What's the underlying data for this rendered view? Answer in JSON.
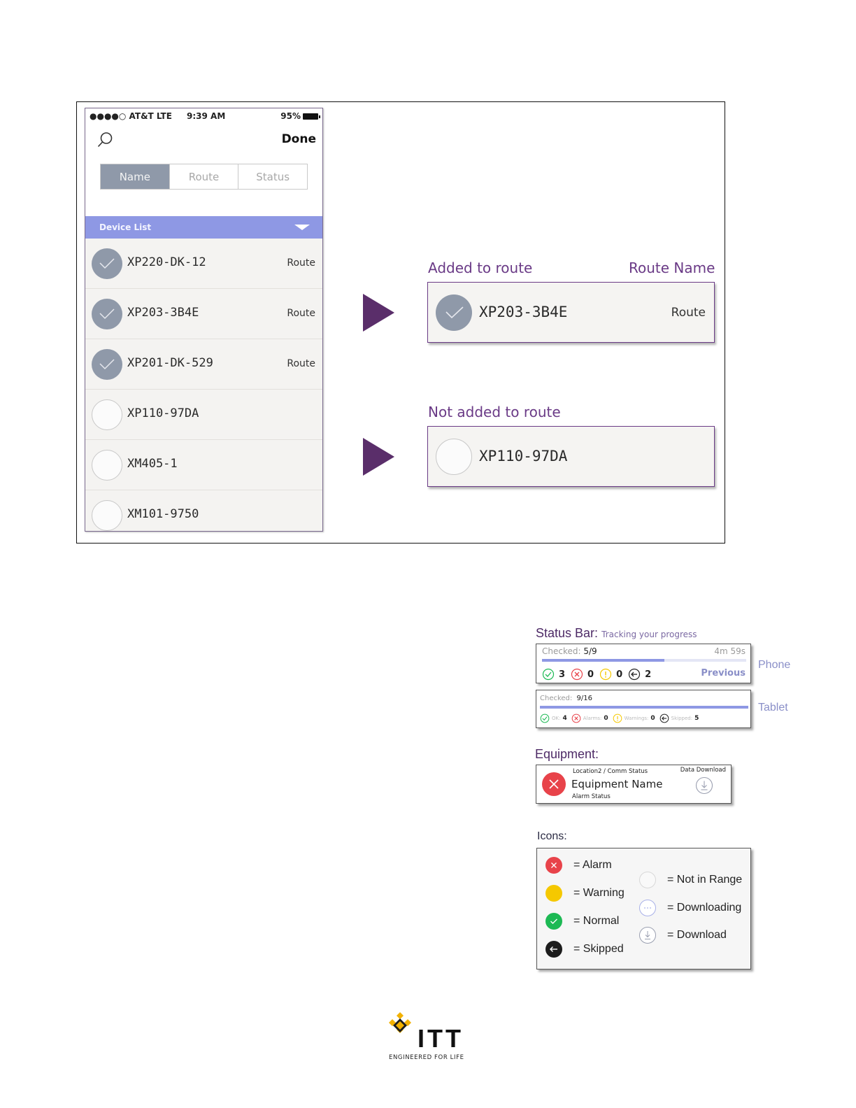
{
  "phone": {
    "carrier": "●●●●○ AT&T  LTE",
    "time": "9:39 AM",
    "battery": "95%",
    "done_label": "Done",
    "tabs": [
      {
        "label": "Name",
        "active": true
      },
      {
        "label": "Route",
        "active": false
      },
      {
        "label": "Status",
        "active": false
      }
    ],
    "device_list_label": "Device List",
    "devices": [
      {
        "name": "XP220-DK-12",
        "route": "Route",
        "checked": true
      },
      {
        "name": "XP203-3B4E",
        "route": "Route",
        "checked": true
      },
      {
        "name": "XP201-DK-529",
        "route": "Route",
        "checked": true
      },
      {
        "name": "XP110-97DA",
        "route": "",
        "checked": false
      },
      {
        "name": "XM405-1",
        "route": "",
        "checked": false
      },
      {
        "name": "XM101-9750",
        "route": "",
        "checked": false
      }
    ]
  },
  "callouts": {
    "added_label": "Added to route",
    "route_name_label": "Route Name",
    "added_card": {
      "name": "XP203-3B4E",
      "route": "Route"
    },
    "not_added_label": "Not added to route",
    "not_added_card": {
      "name": "XP110-97DA"
    }
  },
  "status_bar": {
    "title": "Status Bar:",
    "subtitle": "Tracking  your progress",
    "phone": {
      "checked_label": "Checked:",
      "checked_value": "5/9",
      "timer": "4m 59s",
      "progress": 0.6,
      "counts": {
        "normal": "3",
        "alarm": "0",
        "warning": "0",
        "skipped": "2"
      },
      "previous_label": "Previous",
      "side_label": "Phone"
    },
    "tablet": {
      "checked_label": "Checked:",
      "checked_value": "9/16",
      "progress": 1.0,
      "ok_label": "OK:",
      "ok_value": "4",
      "alarms_label": "Alarms:",
      "alarms_value": "0",
      "warnings_label": "Warnings:",
      "warnings_value": "0",
      "skipped_label": "Skipped:",
      "skipped_value": "5",
      "side_label": "Tablet"
    }
  },
  "equipment": {
    "title": "Equipment:",
    "location": "Location2 / Comm Status",
    "data_download": "Data Download",
    "name": "Equipment Name",
    "alarm_status": "Alarm Status"
  },
  "icons_legend": {
    "title": "Icons:",
    "left": [
      {
        "icon": "alarm-icon",
        "label": "= Alarm",
        "color": "#e8434a"
      },
      {
        "icon": "warning-icon",
        "label": "= Warning",
        "color": "#f5c800"
      },
      {
        "icon": "normal-icon",
        "label": "= Normal",
        "color": "#1db954"
      },
      {
        "icon": "skipped-icon",
        "label": "= Skipped",
        "color": "#1c1c1c"
      }
    ],
    "right": [
      {
        "icon": "not-in-range-icon",
        "label": "= Not in Range"
      },
      {
        "icon": "downloading-icon",
        "label": "= Downloading"
      },
      {
        "icon": "download-icon",
        "label": "= Download"
      }
    ]
  },
  "logo": {
    "text": "ITT",
    "tagline": "ENGINEERED FOR LIFE",
    "brand_color": "#f2b100"
  },
  "colors": {
    "accent_purple": "#6a3a86",
    "device_bar": "#8e98e4",
    "checked_grey": "#8f99a9"
  }
}
